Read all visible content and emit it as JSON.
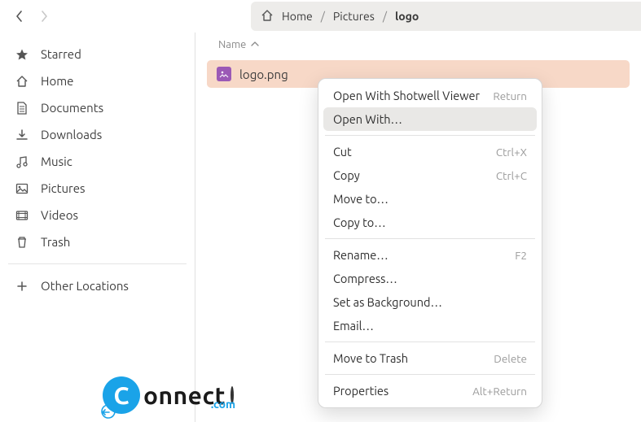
{
  "path": {
    "seg1": "Home",
    "seg2": "Pictures",
    "seg3": "logo"
  },
  "sidebar": {
    "items": [
      {
        "label": "Starred",
        "icon": "star"
      },
      {
        "label": "Home",
        "icon": "home"
      },
      {
        "label": "Documents",
        "icon": "document"
      },
      {
        "label": "Downloads",
        "icon": "download"
      },
      {
        "label": "Music",
        "icon": "music"
      },
      {
        "label": "Pictures",
        "icon": "picture"
      },
      {
        "label": "Videos",
        "icon": "video"
      },
      {
        "label": "Trash",
        "icon": "trash"
      }
    ],
    "other": {
      "label": "Other Locations",
      "icon": "plus"
    }
  },
  "columns": {
    "name": "Name"
  },
  "file": {
    "name": "logo.png"
  },
  "menu": {
    "open_default": "Open With Shotwell Viewer",
    "open_default_accel": "Return",
    "open_with": "Open With…",
    "cut": "Cut",
    "cut_accel": "Ctrl+X",
    "copy": "Copy",
    "copy_accel": "Ctrl+C",
    "move_to": "Move to…",
    "copy_to": "Copy to…",
    "rename": "Rename…",
    "rename_accel": "F2",
    "compress": "Compress…",
    "set_bg": "Set as Background…",
    "email": "Email…",
    "move_trash": "Move to Trash",
    "move_trash_accel": "Delete",
    "properties": "Properties",
    "properties_accel": "Alt+Return"
  },
  "watermark": {
    "letter": "C",
    "word": "onnect",
    "domain": ".com"
  }
}
